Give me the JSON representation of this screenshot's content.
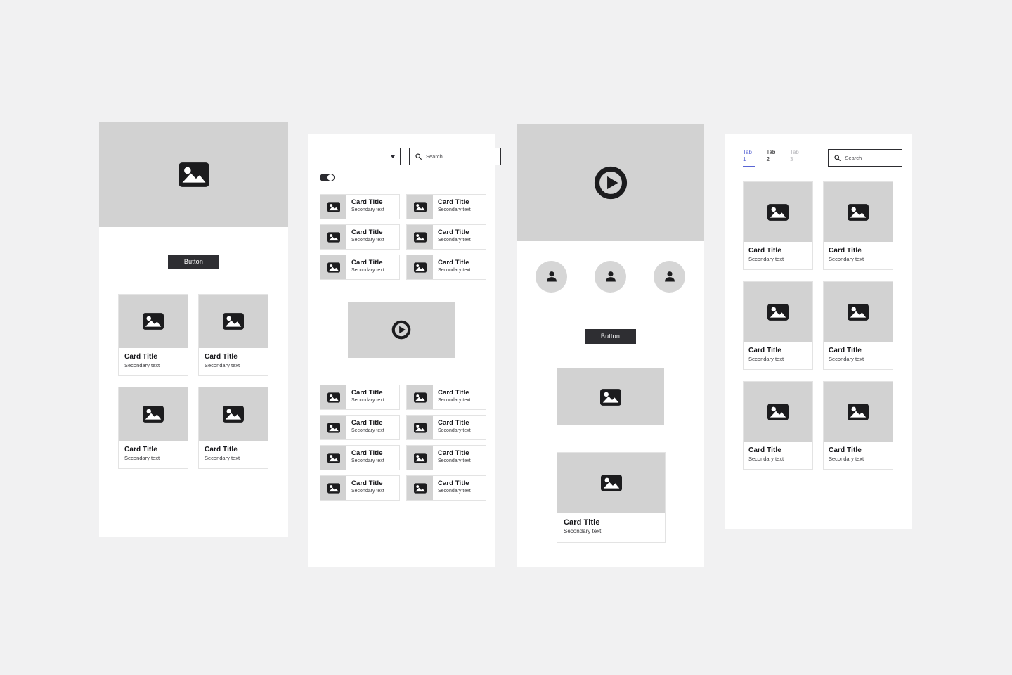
{
  "meta": {
    "background_color": "#f1f1f2",
    "panel_color": "#ffffff",
    "placeholder_color": "#d2d2d2",
    "ink_color": "#1c1c1e",
    "button_color": "#2e2e32",
    "accent_color": "#5965d4",
    "border_color": "#e3e3e3"
  },
  "panel1": {
    "name": "Hero and card grid screen",
    "hero": {
      "icon": "image-placeholder-icon"
    },
    "button": {
      "label": "Button"
    },
    "cards": [
      {
        "title": "Card Title",
        "subtitle": "Secondary text",
        "icon": "image-placeholder-icon"
      },
      {
        "title": "Card Title",
        "subtitle": "Secondary text",
        "icon": "image-placeholder-icon"
      },
      {
        "title": "Card Title",
        "subtitle": "Secondary text",
        "icon": "image-placeholder-icon"
      },
      {
        "title": "Card Title",
        "subtitle": "Secondary text",
        "icon": "image-placeholder-icon"
      }
    ]
  },
  "panel2": {
    "name": "Filter list and video screen",
    "select": {
      "value": "",
      "caret_icon": "chevron-down-icon"
    },
    "search": {
      "value": "",
      "placeholder": "Search",
      "icon": "search-icon"
    },
    "toggle": {
      "state": "on",
      "label": ""
    },
    "list_top": [
      {
        "title": "Card Title",
        "subtitle": "Secondary text",
        "icon": "image-placeholder-icon"
      },
      {
        "title": "Card Title",
        "subtitle": "Secondary text",
        "icon": "image-placeholder-icon"
      },
      {
        "title": "Card Title",
        "subtitle": "Secondary text",
        "icon": "image-placeholder-icon"
      },
      {
        "title": "Card Title",
        "subtitle": "Secondary text",
        "icon": "image-placeholder-icon"
      },
      {
        "title": "Card Title",
        "subtitle": "Secondary text",
        "icon": "image-placeholder-icon"
      },
      {
        "title": "Card Title",
        "subtitle": "Secondary text",
        "icon": "image-placeholder-icon"
      }
    ],
    "video": {
      "icon": "play-button-icon"
    },
    "list_bottom": [
      {
        "title": "Card Title",
        "subtitle": "Secondary text",
        "icon": "image-placeholder-icon"
      },
      {
        "title": "Card Title",
        "subtitle": "Secondary text",
        "icon": "image-placeholder-icon"
      },
      {
        "title": "Card Title",
        "subtitle": "Secondary text",
        "icon": "image-placeholder-icon"
      },
      {
        "title": "Card Title",
        "subtitle": "Secondary text",
        "icon": "image-placeholder-icon"
      },
      {
        "title": "Card Title",
        "subtitle": "Secondary text",
        "icon": "image-placeholder-icon"
      },
      {
        "title": "Card Title",
        "subtitle": "Secondary text",
        "icon": "image-placeholder-icon"
      },
      {
        "title": "Card Title",
        "subtitle": "Secondary text",
        "icon": "image-placeholder-icon"
      },
      {
        "title": "Card Title",
        "subtitle": "Secondary text",
        "icon": "image-placeholder-icon"
      }
    ]
  },
  "panel3": {
    "name": "Video hero, avatars and cards screen",
    "hero": {
      "icon": "play-button-icon"
    },
    "avatars": [
      {
        "icon": "person-avatar-icon"
      },
      {
        "icon": "person-avatar-icon"
      },
      {
        "icon": "person-avatar-icon"
      }
    ],
    "button": {
      "label": "Button"
    },
    "image_block": {
      "icon": "image-placeholder-icon"
    },
    "card": {
      "title": "Card Title",
      "subtitle": "Secondary text",
      "icon": "image-placeholder-icon"
    }
  },
  "panel4": {
    "name": "Tabbed card grid screen",
    "tabs": [
      {
        "label": "Tab 1",
        "state": "active"
      },
      {
        "label": "Tab 2",
        "state": "default"
      },
      {
        "label": "Tab 3",
        "state": "disabled"
      }
    ],
    "search": {
      "value": "",
      "placeholder": "Search",
      "icon": "search-icon"
    },
    "cards": [
      {
        "title": "Card Title",
        "subtitle": "Secondary text",
        "icon": "image-placeholder-icon"
      },
      {
        "title": "Card Title",
        "subtitle": "Secondary text",
        "icon": "image-placeholder-icon"
      },
      {
        "title": "Card Title",
        "subtitle": "Secondary text",
        "icon": "image-placeholder-icon"
      },
      {
        "title": "Card Title",
        "subtitle": "Secondary text",
        "icon": "image-placeholder-icon"
      },
      {
        "title": "Card Title",
        "subtitle": "Secondary text",
        "icon": "image-placeholder-icon"
      },
      {
        "title": "Card Title",
        "subtitle": "Secondary text",
        "icon": "image-placeholder-icon"
      }
    ]
  }
}
